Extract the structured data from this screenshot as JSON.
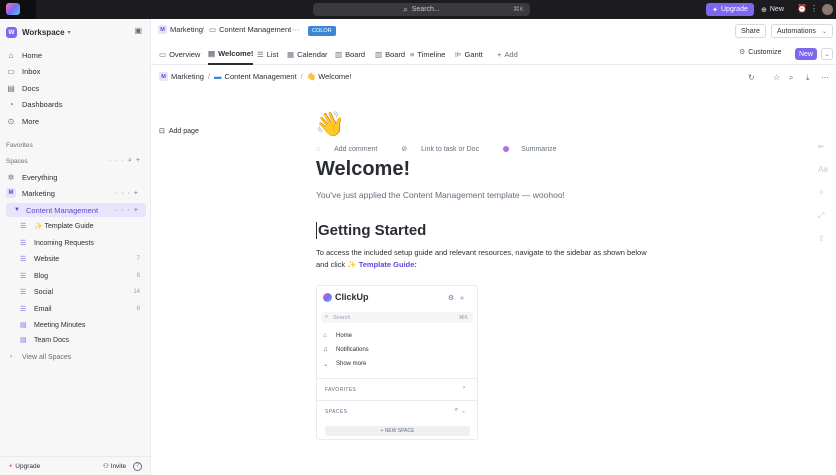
{
  "topbar": {
    "search_placeholder": "Search...",
    "search_shortcut": "⌘K",
    "upgrade_label": "Upgrade",
    "new_label": "New"
  },
  "sidebar": {
    "workspace_badge": "W",
    "workspace_name": "Workspace",
    "nav": [
      {
        "label": "Home",
        "icon": "home-icon"
      },
      {
        "label": "Inbox",
        "icon": "inbox-icon"
      },
      {
        "label": "Docs",
        "icon": "docs-icon"
      },
      {
        "label": "Dashboards",
        "icon": "dashboards-icon"
      },
      {
        "label": "More",
        "icon": "more-icon"
      }
    ],
    "favorites_label": "Favorites",
    "spaces_label": "Spaces",
    "everything_label": "Everything",
    "space_badge": "M",
    "space_name": "Marketing",
    "folder_name": "Content Management",
    "lists": [
      {
        "label": "✨ Template Guide",
        "count": ""
      },
      {
        "label": "Incoming Requests",
        "count": ""
      },
      {
        "label": "Website",
        "count": "7"
      },
      {
        "label": "Blog",
        "count": "8"
      },
      {
        "label": "Social",
        "count": "14"
      },
      {
        "label": "Email",
        "count": "8"
      },
      {
        "label": "Meeting Minutes",
        "count": ""
      },
      {
        "label": "Team Docs",
        "count": ""
      }
    ],
    "view_all": "View all Spaces",
    "upgrade": "Upgrade",
    "invite": "Invite",
    "help": "?"
  },
  "header": {
    "crumb_space_badge": "M",
    "crumb_space": "Marketing",
    "crumb_folder": "Content Management",
    "more": "···",
    "color_chip": "COLOR",
    "share": "Share",
    "automations": "Automations"
  },
  "tabs": [
    {
      "label": "Overview",
      "icon": "overview-icon"
    },
    {
      "label": "Welcome!",
      "icon": "doc-icon"
    },
    {
      "label": "List",
      "icon": "list-icon"
    },
    {
      "label": "Calendar",
      "icon": "calendar-icon"
    },
    {
      "label": "Board",
      "icon": "board-icon"
    },
    {
      "label": "Board",
      "icon": "board-icon"
    },
    {
      "label": "Timeline",
      "icon": "timeline-icon"
    },
    {
      "label": "Gantt",
      "icon": "gantt-icon"
    },
    {
      "label": "Add",
      "icon": "plus-icon"
    }
  ],
  "tab_tools": {
    "customize": "Customize",
    "new": "New"
  },
  "path": {
    "space_badge": "M",
    "space": "Marketing",
    "folder": "Content Management",
    "doc": "👋 Welcome!"
  },
  "doc": {
    "add_page": "Add page",
    "emoji": "👋",
    "actions": {
      "comment": "Add comment",
      "link": "Link to task or Doc",
      "summarize": "Summarize"
    },
    "title": "Welcome!",
    "subtitle": "You've just applied the Content Management template — woohoo!",
    "h2": "Getting Started",
    "p_text": "To access the included setup guide and relevant resources, navigate to the sidebar as shown below and click",
    "p_link": "✨ Template Guide:"
  },
  "preview": {
    "brand": "ClickUp",
    "search": "Search",
    "shortcut": "⌘K",
    "items": [
      "Home",
      "Notifications",
      "Show more"
    ],
    "favorites": "FAVORITES",
    "spaces": "SPACES",
    "new_space": "+ NEW SPACE"
  },
  "colors": {
    "accent": "#7b68ee",
    "chip": "#3a87d8",
    "topbar": "#1c1c1e"
  }
}
